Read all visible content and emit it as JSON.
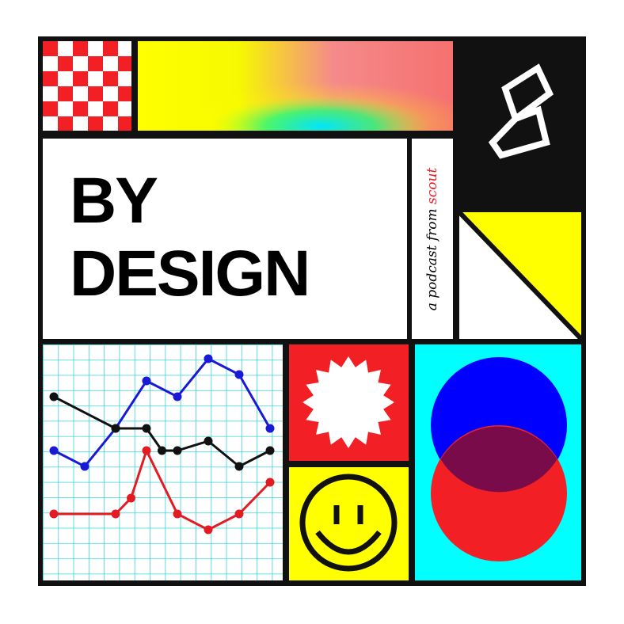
{
  "title": {
    "line1": "BY",
    "line2": "DESIGN"
  },
  "tagline": {
    "prefix": "a podcast from ",
    "brand": "scout"
  },
  "colors": {
    "black": "#111111",
    "red": "#f22025",
    "yellow": "#ffff00",
    "cyan": "#00ffff",
    "blue": "#0000ff",
    "overlap": "#7a0b4a",
    "grid": "#38d3d9"
  },
  "icons": [
    "checkerboard-pattern",
    "gradient-panel",
    "scout-logo-icon",
    "triangle-panel",
    "starburst-icon",
    "smiley-face-icon",
    "venn-circles"
  ],
  "chart_data": {
    "type": "line",
    "series": [
      {
        "color": "#1a1ad6",
        "values": [
          [
            0,
            3.3
          ],
          [
            1,
            2.8
          ],
          [
            2,
            4.0
          ],
          [
            3,
            5.5
          ],
          [
            4,
            5.0
          ],
          [
            5,
            6.2
          ],
          [
            6,
            5.7
          ],
          [
            7,
            4.0
          ]
        ]
      },
      {
        "color": "#111111",
        "values": [
          [
            0,
            5.0
          ],
          [
            2,
            4.0
          ],
          [
            3,
            4.0
          ],
          [
            3.5,
            3.3
          ],
          [
            4,
            3.3
          ],
          [
            5,
            3.6
          ],
          [
            6,
            2.8
          ],
          [
            7,
            3.3
          ]
        ]
      },
      {
        "color": "#e31b23",
        "values": [
          [
            0,
            1.3
          ],
          [
            2,
            1.3
          ],
          [
            2.5,
            1.8
          ],
          [
            3,
            3.3
          ],
          [
            4,
            1.3
          ],
          [
            5,
            0.8
          ],
          [
            6,
            1.3
          ],
          [
            7,
            2.3
          ]
        ]
      }
    ]
  }
}
